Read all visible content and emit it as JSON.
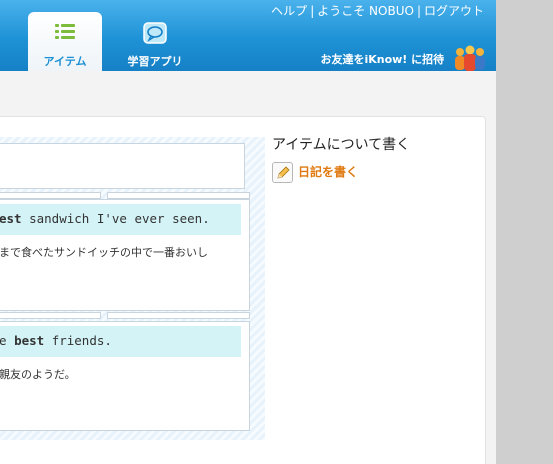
{
  "header": {
    "top_links": [
      "ヘルプ",
      "ようこそ NOBUO",
      "ログアウト"
    ],
    "tabs": [
      {
        "label": "アイテム",
        "icon": "list-icon",
        "active": true
      },
      {
        "label": "学習アプリ",
        "icon": "speech-bubble-icon",
        "active": false
      }
    ],
    "invite_label": "お友達をiKnow! に招待",
    "invite_icon": "people-icon"
  },
  "sidebar": {
    "title": "アイテムについて書く",
    "diary_link": "日記を書く",
    "diary_icon": "pencil-icon"
  },
  "sentences": [
    {
      "pre": "est",
      "post": " sandwich I've ever seen.",
      "translation": "まで食べたサンドイッチの中で一番おいし"
    },
    {
      "pre_plain": "e ",
      "pre": "best",
      "post": " friends.",
      "translation": "親友のようだ。"
    }
  ],
  "colors": {
    "header": "#1e92d6",
    "link_orange": "#e07a10",
    "sentence_bg": "#d4f3f6"
  }
}
